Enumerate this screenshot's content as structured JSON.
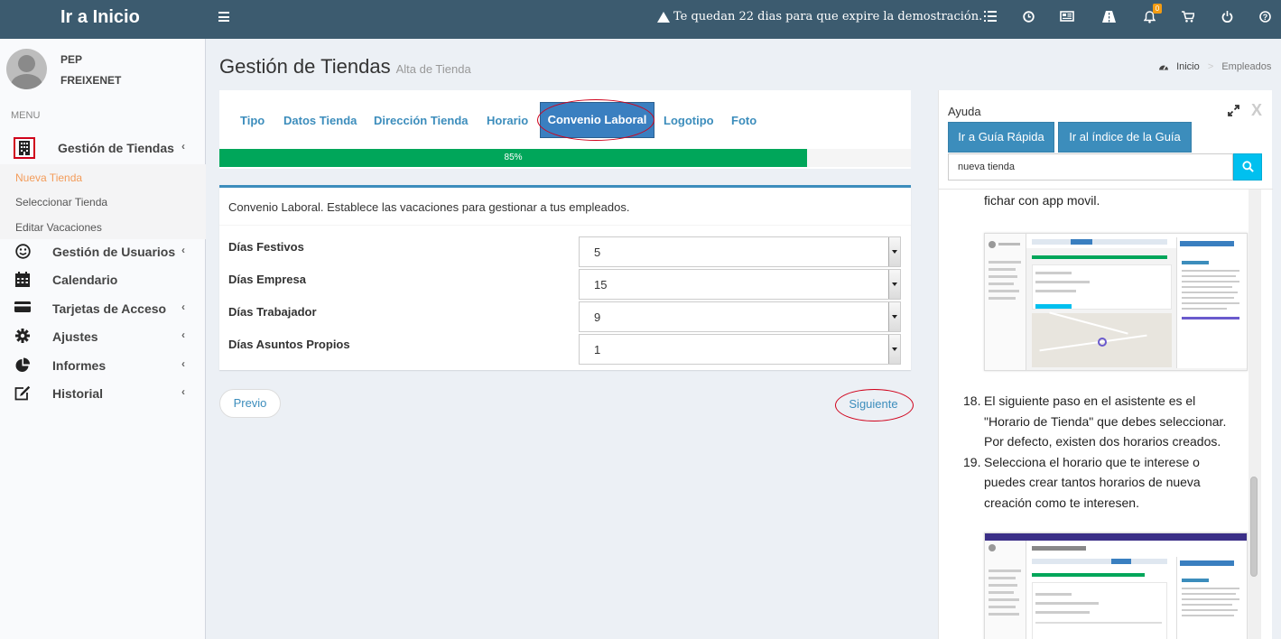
{
  "topbar": {
    "brand": "Ir a Inicio",
    "warning": "Te quedan 22 dias para que expire la demostración.",
    "notif_count": "0",
    "icons": [
      "menu-icon",
      "list-icon",
      "clock-icon",
      "newspaper-icon",
      "road-icon",
      "bell-icon",
      "cart-icon",
      "power-icon",
      "help-icon"
    ]
  },
  "user": {
    "first": "PEP",
    "last": "FREIXENET"
  },
  "sidebar": {
    "menu_header": "MENU",
    "items": [
      {
        "label": "Gestión de Tiendas",
        "icon": "building-icon"
      },
      {
        "label": "Gestión de Usuarios",
        "icon": "smile-icon"
      },
      {
        "label": "Calendario",
        "icon": "calendar-icon"
      },
      {
        "label": "Tarjetas de Acceso",
        "icon": "credit-card-icon"
      },
      {
        "label": "Ajustes",
        "icon": "gear-icon"
      },
      {
        "label": "Informes",
        "icon": "pie-chart-icon"
      },
      {
        "label": "Historial",
        "icon": "edit-icon"
      }
    ],
    "sub_items": [
      "Nueva Tienda",
      "Seleccionar Tienda",
      "Editar Vacaciones"
    ]
  },
  "page": {
    "title": "Gestión de Tiendas",
    "subtitle": "Alta de Tienda"
  },
  "breadcrumb": {
    "home": "Inicio",
    "sep": ">",
    "current": "Empleados"
  },
  "wizard": {
    "tabs": [
      "Tipo",
      "Datos Tienda",
      "Dirección Tienda",
      "Horario",
      "Convenio Laboral",
      "Logotipo",
      "Foto"
    ],
    "active_tab": "Convenio Laboral",
    "progress": 85,
    "progress_label": "85%"
  },
  "form": {
    "description": "Convenio Laboral. Establece las vacaciones para gestionar a tus empleados.",
    "fields": [
      {
        "label": "Días Festivos",
        "value": "5"
      },
      {
        "label": "Días Empresa",
        "value": "15"
      },
      {
        "label": "Días Trabajador",
        "value": "9"
      },
      {
        "label": "Días Asuntos Propios",
        "value": "1"
      }
    ],
    "prev_label": "Previo",
    "next_label": "Siguiente"
  },
  "help": {
    "title": "Ayuda",
    "quick_guide_btn": "Ir a Guía Rápida",
    "index_btn": "Ir al índice de la Guía",
    "search_value": "nueva tienda",
    "text_top": "fichar con app movil.",
    "steps": [
      {
        "num": "18.",
        "lines": [
          "El siguiente paso en el asistente es el",
          "\"Horario de Tienda\" que debes seleccionar.",
          "Por defecto, existen dos horarios creados."
        ]
      },
      {
        "num": "19.",
        "lines": [
          "Selecciona el horario que te interese o",
          "puedes crear tantos horarios de nueva",
          "creación como te interesen."
        ]
      }
    ]
  }
}
